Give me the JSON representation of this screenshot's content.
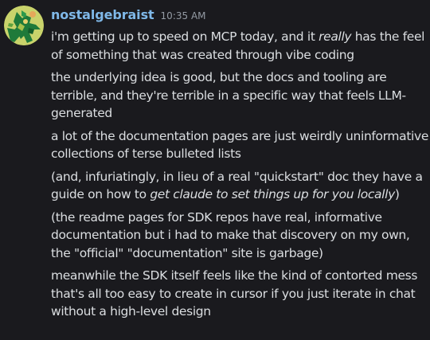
{
  "author": {
    "username": "nostalgebraist",
    "timestamp": "10:35 AM"
  },
  "colors": {
    "background": "#1a1a1e",
    "username": "#7fb8e8",
    "text": "#dbdee1",
    "timestamp": "#949ba4",
    "avatar_background": "#c9d36b",
    "avatar_figure": "#1f7a3a"
  },
  "avatar_icon": "green-figure-on-yellow-avatar-icon",
  "paragraphs": [
    {
      "lines": [
        [
          {
            "text": "i'm getting up to speed on MCP today, and it ",
            "italic": false
          },
          {
            "text": "really",
            "italic": true
          },
          {
            "text": " has the feel",
            "italic": false
          }
        ],
        [
          {
            "text": "of something that was created through vibe coding",
            "italic": false
          }
        ]
      ]
    },
    {
      "lines": [
        [
          {
            "text": "the underlying idea is good, but the docs and tooling are",
            "italic": false
          }
        ],
        [
          {
            "text": "terrible, and they're terrible in a specific way that feels LLM-",
            "italic": false
          }
        ],
        [
          {
            "text": "generated",
            "italic": false
          }
        ]
      ]
    },
    {
      "lines": [
        [
          {
            "text": "a lot of the documentation pages are just weirdly uninformative",
            "italic": false
          }
        ],
        [
          {
            "text": "collections of terse bulleted lists",
            "italic": false
          }
        ]
      ]
    },
    {
      "lines": [
        [
          {
            "text": "(and, infuriatingly, in lieu of a real \"quickstart\" doc they have a",
            "italic": false
          }
        ],
        [
          {
            "text": "guide on how to ",
            "italic": false
          },
          {
            "text": "get claude to set things up for you locally",
            "italic": true
          },
          {
            "text": ")",
            "italic": false
          }
        ]
      ]
    },
    {
      "lines": [
        [
          {
            "text": "(the readme pages for SDK repos have real, informative",
            "italic": false
          }
        ],
        [
          {
            "text": "documentation but i had to make that discovery on my own,",
            "italic": false
          }
        ],
        [
          {
            "text": "the \"official\" \"documentation\" site is garbage)",
            "italic": false
          }
        ]
      ]
    },
    {
      "lines": [
        [
          {
            "text": "meanwhile the SDK itself feels like the kind of contorted mess",
            "italic": false
          }
        ],
        [
          {
            "text": "that's all too easy to create in cursor if you just iterate in chat",
            "italic": false
          }
        ],
        [
          {
            "text": "without a high-level design",
            "italic": false
          }
        ]
      ]
    }
  ]
}
